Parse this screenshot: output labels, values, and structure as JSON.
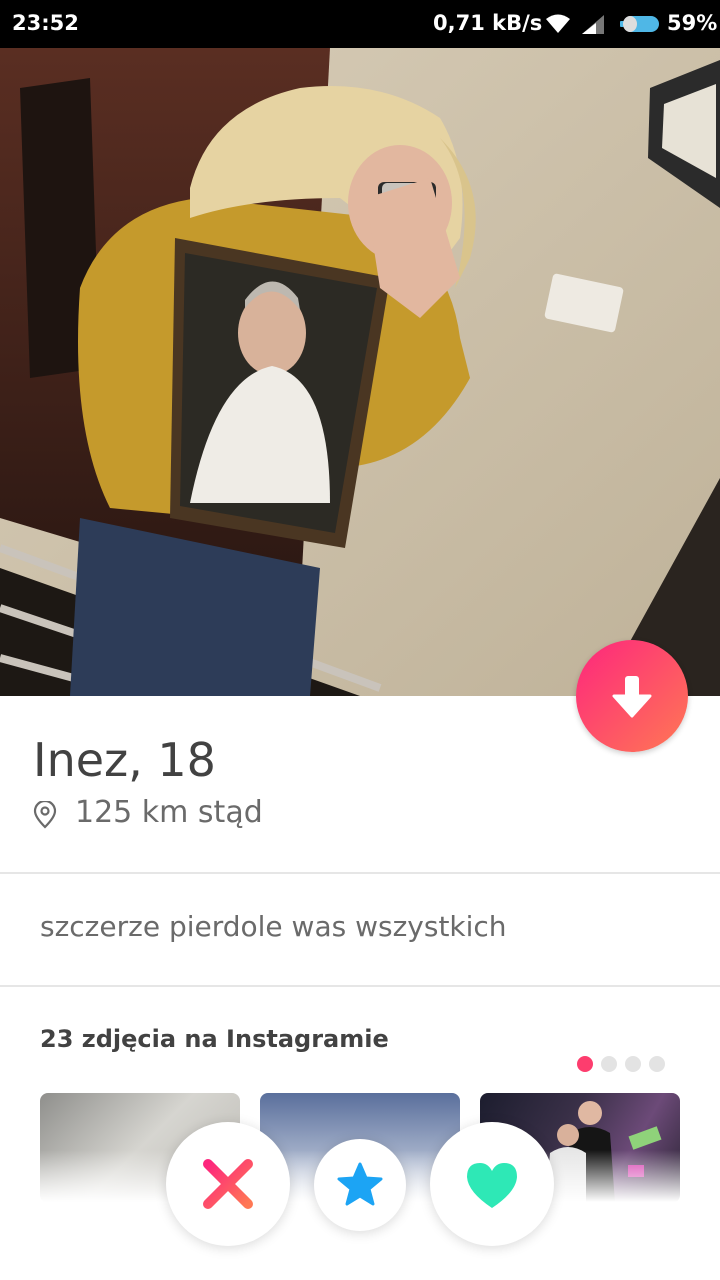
{
  "status_bar": {
    "time": "23:52",
    "net_speed": "0,71 kB/s",
    "battery": "59%",
    "icons": [
      "wifi-icon",
      "signal-icon",
      "battery-icon"
    ]
  },
  "profile": {
    "name_age": "Inez, 18",
    "distance": "125 km stąd",
    "bio": "szczerze pierdole was wszystkich"
  },
  "instagram": {
    "title": "23 zdjęcia na Instagramie",
    "pages": 4,
    "current_page": 1
  },
  "actions": {
    "dislike": "x-icon",
    "super_like": "star-icon",
    "like": "heart-icon"
  },
  "colors": {
    "brand_gradient_start": "#fd267d",
    "brand_gradient_end": "#ff7854",
    "super_like": "#1ca4f4",
    "like": "#2ee8b6"
  }
}
